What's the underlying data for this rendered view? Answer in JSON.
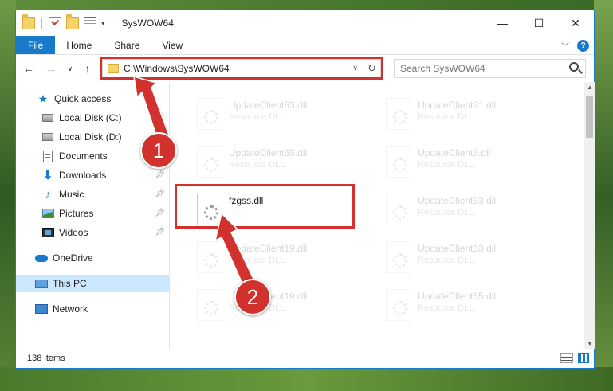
{
  "window": {
    "title": "SysWOW64"
  },
  "title_bar": {
    "controls": {
      "minimize": "—",
      "maximize": "☐",
      "close": "✕"
    }
  },
  "ribbon": {
    "tabs": [
      {
        "label": "File"
      },
      {
        "label": "Home"
      },
      {
        "label": "Share"
      },
      {
        "label": "View"
      }
    ],
    "help": "?"
  },
  "address_bar": {
    "path": "C:\\Windows\\SysWOW64",
    "search_placeholder": "Search SysWOW64"
  },
  "sidebar": {
    "items": [
      {
        "label": "Quick access",
        "icon": "star-icon"
      },
      {
        "label": "Local Disk (C:)",
        "icon": "disk-icon",
        "pinned": true
      },
      {
        "label": "Local Disk (D:)",
        "icon": "disk-icon"
      },
      {
        "label": "Documents",
        "icon": "documents-icon"
      },
      {
        "label": "Downloads",
        "icon": "downloads-icon",
        "pinned": true
      },
      {
        "label": "Music",
        "icon": "music-icon",
        "pinned": true
      },
      {
        "label": "Pictures",
        "icon": "pictures-icon",
        "pinned": true
      },
      {
        "label": "Videos",
        "icon": "videos-icon",
        "pinned": true
      },
      {
        "label": "OneDrive",
        "icon": "onedrive-icon"
      },
      {
        "label": "This PC",
        "icon": "this-pc-icon",
        "selected": true
      },
      {
        "label": "Network",
        "icon": "network-icon"
      }
    ]
  },
  "files": [
    {
      "name": "UpdateClient63.dll",
      "type": "Resource DLL",
      "faded": true
    },
    {
      "name": "UpdateClient21.dll",
      "type": "Resource DLL",
      "faded": true
    },
    {
      "name": "UpdateClient63.dll",
      "type": "Resource DLL",
      "faded": true
    },
    {
      "name": "UpdateClient5.dll",
      "type": "Resource DLL",
      "faded": true
    },
    {
      "name": "fzgss.dll",
      "type": "",
      "faded": false
    },
    {
      "name": "UpdateClient63.dll",
      "type": "Resource DLL",
      "faded": true
    },
    {
      "name": "UpdateClient19.dll",
      "type": "Resource DLL",
      "faded": true
    },
    {
      "name": "UpdateClient63.dll",
      "type": "Resource DLL",
      "faded": true
    },
    {
      "name": "UpdateClient19.dll",
      "type": "Resource DLL",
      "faded": true
    },
    {
      "name": "UpdateClient65.dll",
      "type": "Resource DLL",
      "faded": true
    }
  ],
  "status_bar": {
    "item_count": "138 items"
  },
  "annotations": {
    "step1": "1",
    "step2": "2",
    "color": "#d2322d"
  }
}
